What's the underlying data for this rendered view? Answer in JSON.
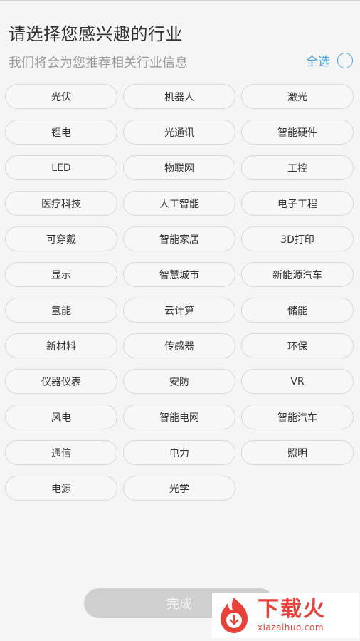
{
  "header": {
    "title": "请选择您感兴趣的行业",
    "subtitle": "我们将会为您推荐相关行业信息",
    "select_all_label": "全选"
  },
  "industries": [
    "光伏",
    "机器人",
    "激光",
    "锂电",
    "光通讯",
    "智能硬件",
    "LED",
    "物联网",
    "工控",
    "医疗科技",
    "人工智能",
    "电子工程",
    "可穿戴",
    "智能家居",
    "3D打印",
    "显示",
    "智慧城市",
    "新能源汽车",
    "氢能",
    "云计算",
    "储能",
    "新材料",
    "传感器",
    "环保",
    "仪器仪表",
    "安防",
    "VR",
    "风电",
    "智能电网",
    "智能汽车",
    "通信",
    "电力",
    "照明",
    "电源",
    "光学"
  ],
  "footer": {
    "done_label": "完成"
  },
  "watermark": {
    "text_cn": "下载火",
    "text_en": "xiazaihuo.com"
  },
  "colors": {
    "accent": "#4aa3df",
    "watermark": "#e8413a",
    "button_disabled": "#cfcfcf"
  }
}
